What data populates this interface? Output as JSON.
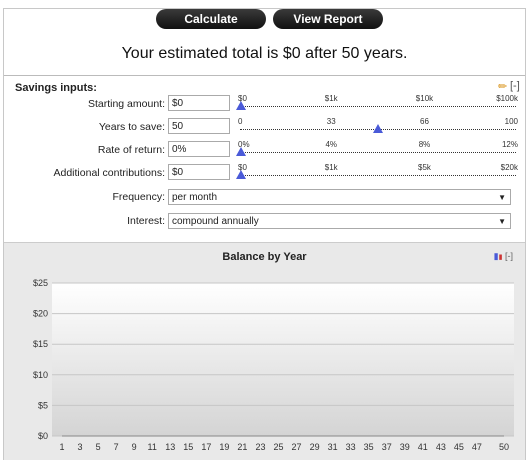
{
  "header": {
    "calculate_label": "Calculate",
    "view_report_label": "View Report",
    "result_text": "Your estimated total is $0 after 50 years."
  },
  "inputs": {
    "title": "Savings inputs:",
    "collapse_label": "[-]",
    "fields": [
      {
        "label": "Starting amount:",
        "value": "$0",
        "ticks": [
          "$0",
          "$1k",
          "$10k",
          "$100k"
        ],
        "slider_fraction": 0.0
      },
      {
        "label": "Years to save:",
        "value": "50",
        "ticks": [
          "0",
          "33",
          "66",
          "100"
        ],
        "slider_fraction": 0.5
      },
      {
        "label": "Rate of return:",
        "value": "0%",
        "ticks": [
          "0%",
          "4%",
          "8%",
          "12%"
        ],
        "slider_fraction": 0.0
      },
      {
        "label": "Additional contributions:",
        "value": "$0",
        "ticks": [
          "$0",
          "$1k",
          "$5k",
          "$20k"
        ],
        "slider_fraction": 0.0
      }
    ],
    "frequency": {
      "label": "Frequency:",
      "value": "per month"
    },
    "interest": {
      "label": "Interest:",
      "value": "compound annually"
    }
  },
  "chart_panel": {
    "collapse_label": "[-]"
  },
  "chart_data": {
    "type": "area",
    "title": "Balance by Year",
    "xlabel": "",
    "ylabel": "",
    "x_tick_labels": [
      "1",
      "3",
      "5",
      "7",
      "9",
      "11",
      "13",
      "15",
      "17",
      "19",
      "21",
      "23",
      "25",
      "27",
      "29",
      "31",
      "33",
      "35",
      "37",
      "39",
      "41",
      "43",
      "45",
      "47",
      "50"
    ],
    "y_tick_labels": [
      "$0",
      "$5",
      "$10",
      "$15",
      "$20",
      "$25"
    ],
    "ylim": [
      0,
      25
    ],
    "xlim": [
      1,
      50
    ],
    "series": [
      {
        "values": [
          0
        ]
      }
    ],
    "grid": true
  },
  "colors": {
    "slider_handle": "#4a5ad8",
    "button_bg": "#1e1e1e"
  }
}
